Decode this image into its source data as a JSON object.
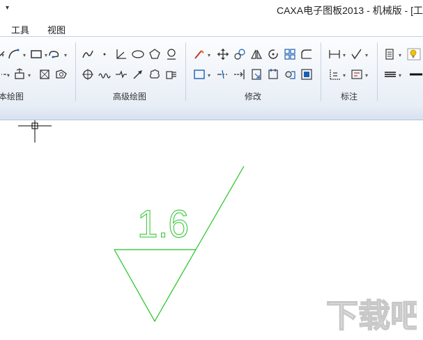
{
  "window": {
    "title": "CAXA电子图板2013 - 机械版 - [工",
    "quick_access_icon": "dropdown-arrow-icon"
  },
  "menu": {
    "items": [
      "工具",
      "视图"
    ]
  },
  "ribbon": {
    "groups": [
      {
        "label": "本绘图"
      },
      {
        "label": "高级绘图"
      },
      {
        "label": "修改"
      },
      {
        "label": "标注"
      }
    ]
  },
  "drawing": {
    "roughness_value": "1.6",
    "stroke_color": "#22c322"
  },
  "watermark": {
    "text": "下载吧"
  }
}
